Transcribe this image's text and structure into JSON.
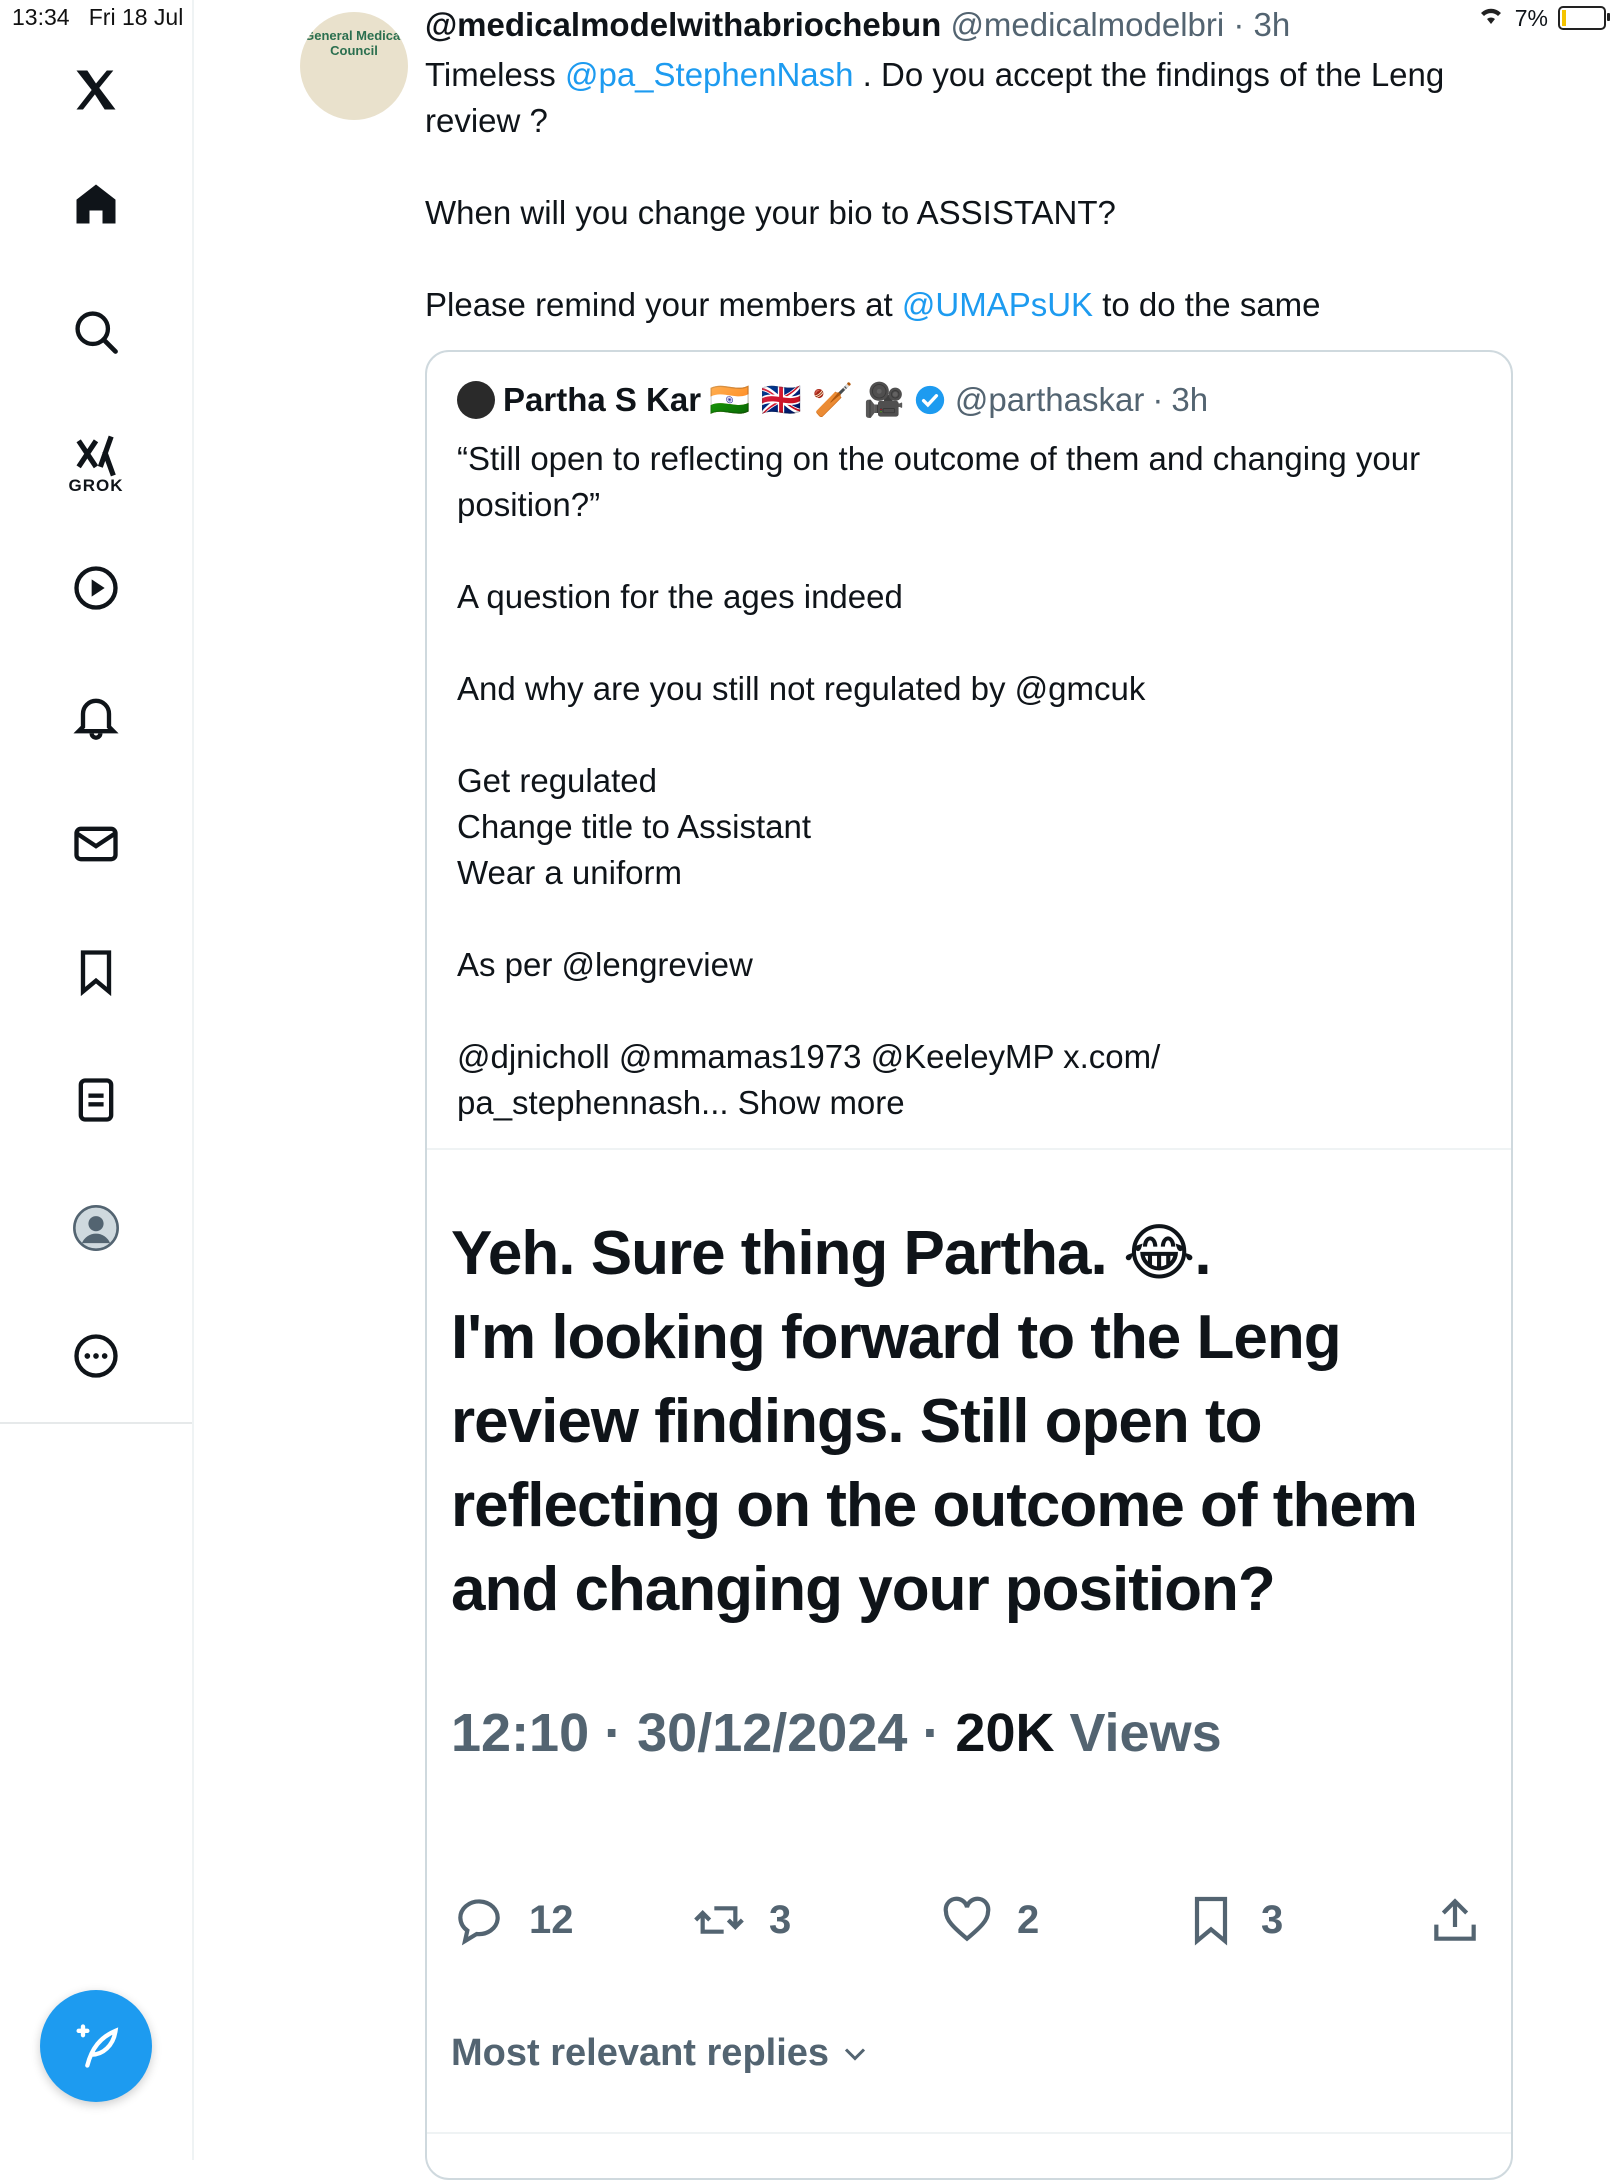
{
  "status_bar": {
    "time": "13:34",
    "date": "Fri 18 Jul",
    "battery": "7%"
  },
  "sidebar": {
    "grok_label": "GROK"
  },
  "tweet": {
    "display_name": "@medicalmodelwithabriochebun",
    "handle": "@medicalmodelbri",
    "time": "3h",
    "avatar_text": "General Medical Council",
    "text_p1_prefix": "Timeless ",
    "mention_1": "@pa_StephenNash",
    "text_p1_suffix": " . Do you accept the findings of the Leng review ?",
    "text_p2": "When will you change your bio to ASSISTANT?",
    "text_p3_prefix": "Please remind your members at ",
    "mention_2": "@UMAPsUK",
    "text_p3_suffix": " to do the same"
  },
  "quote": {
    "name": "Partha S Kar",
    "name_emojis": "🇮🇳 🇬🇧 🏏 🎥",
    "handle": "@parthaskar",
    "time": "3h",
    "lines": [
      "“Still open to reflecting on the outcome of them and changing your position?”",
      "A question for the ages indeed",
      "And why are you still not regulated by @gmcuk",
      "Get regulated",
      "Change title to Assistant",
      "Wear a uniform",
      "As per @lengreview",
      "@djnicholl @mmamas1973 @KeeleyMP x.com/",
      "pa_stephennash... Show more"
    ],
    "big_text_1": "Yeh. Sure thing Partha. 😂.",
    "big_text_2": "I'm looking forward to the Leng review findings. Still open to reflecting on the outcome of them and changing your position?",
    "stamp_time": "12:10",
    "stamp_date": "30/12/2024",
    "stamp_views_count": "20K",
    "stamp_views_label": "Views",
    "stats": {
      "replies": "12",
      "reposts": "3",
      "likes": "2",
      "bookmarks": "3"
    },
    "sort_label": "Most relevant replies"
  }
}
